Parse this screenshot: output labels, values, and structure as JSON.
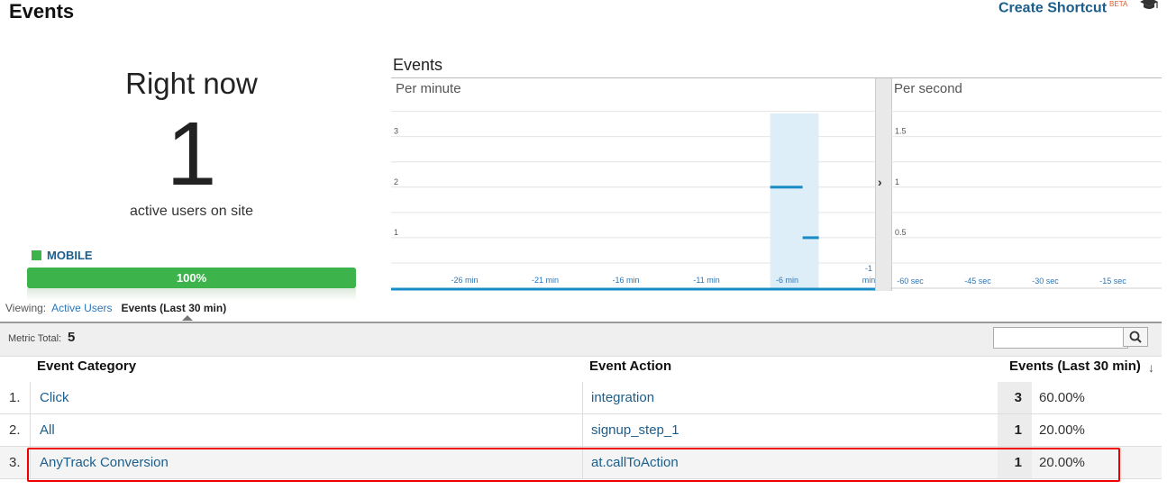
{
  "page": {
    "title": "Events"
  },
  "shortcut": {
    "label": "Create Shortcut",
    "badge": "BETA"
  },
  "realtime": {
    "heading": "Right now",
    "active_users": "1",
    "active_label": "active users on site",
    "device_label": "MOBILE",
    "device_percent_text": "100%",
    "device_share": 1.0,
    "device_color": "#3cb44b"
  },
  "viewing": {
    "label": "Viewing:",
    "option1": "Active Users",
    "option2": "Events (Last 30 min)"
  },
  "chart_data": [
    {
      "type": "bar",
      "title": "Events",
      "subtitle": "Per minute",
      "x": [
        "-30 min",
        "-29 min",
        "-28 min",
        "-27 min",
        "-26 min",
        "-25 min",
        "-24 min",
        "-23 min",
        "-22 min",
        "-21 min",
        "-20 min",
        "-19 min",
        "-18 min",
        "-17 min",
        "-16 min",
        "-15 min",
        "-14 min",
        "-13 min",
        "-12 min",
        "-11 min",
        "-10 min",
        "-9 min",
        "-8 min",
        "-7 min",
        "-6 min",
        "-5 min",
        "-4 min",
        "-3 min",
        "-2 min",
        "-1 min"
      ],
      "values": [
        0,
        0,
        0,
        0,
        0,
        0,
        0,
        0,
        0,
        0,
        0,
        0,
        0,
        0,
        0,
        0,
        0,
        0,
        0,
        0,
        0,
        0,
        0,
        0,
        2,
        1,
        0,
        0,
        0,
        0
      ],
      "x_ticks": [
        "-26 min",
        "-21 min",
        "-16 min",
        "-11 min",
        "-6 min",
        "-1 min"
      ],
      "y_ticks": [
        1,
        2,
        3
      ],
      "ylim": [
        0,
        3.6
      ],
      "highlight": "-6 min",
      "color": "#1a8bc4"
    },
    {
      "type": "bar",
      "subtitle": "Per second",
      "x_ticks": [
        "-60 sec",
        "-45 sec",
        "-30 sec",
        "-15 sec"
      ],
      "y_ticks": [
        0.5,
        1,
        1.5
      ],
      "ylim": [
        0,
        1.8
      ],
      "values": [],
      "color": "#1a8bc4"
    }
  ],
  "table": {
    "metric_total_label": "Metric Total:",
    "metric_total": "5",
    "search": {
      "placeholder": ""
    },
    "columns": [
      "Event Category",
      "Event Action",
      "Events (Last 30 min)"
    ],
    "rows": [
      {
        "idx": "1.",
        "category": "Click",
        "action": "integration",
        "count": "3",
        "percent": "60.00%"
      },
      {
        "idx": "2.",
        "category": "All",
        "action": "signup_step_1",
        "count": "1",
        "percent": "20.00%"
      },
      {
        "idx": "3.",
        "category": "AnyTrack Conversion",
        "action": "at.callToAction",
        "count": "1",
        "percent": "20.00%"
      }
    ]
  },
  "colors": {
    "link": "#1b5e8c",
    "highlight_border": "#e00000"
  }
}
